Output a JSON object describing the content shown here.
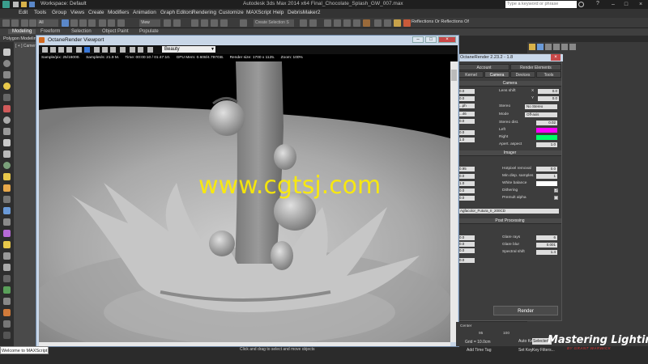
{
  "window": {
    "title": "Autodesk 3ds Max 2014 x64     Final_Chocolate_Splash_GW_007.max",
    "workspace": "Workspace: Default",
    "search_placeholder": "Type a keyword or phrase"
  },
  "menu": [
    "Edit",
    "Tools",
    "Group",
    "Views",
    "Create",
    "Modifiers",
    "Animation",
    "Graph Editors",
    "Rendering",
    "Customize",
    "MAXScript",
    "Help",
    "DebrisMaker2"
  ],
  "toolbar": {
    "filter_dropdown": "All",
    "coord_dropdown": "View",
    "selection_set": "Create Selection S",
    "reflections_label": "Reflections Or Reflections Of"
  },
  "ribbon": {
    "tabs": [
      "Modeling",
      "Freeform",
      "Selection",
      "Object Paint",
      "Populate"
    ],
    "active": "Modeling",
    "sub_label": "Polygon Modeling"
  },
  "background_viewport": {
    "label": "[ + ] Camer"
  },
  "octane": {
    "title": "OctaneRender Viewport",
    "render_pass": "Beauty",
    "stats": {
      "samples_pix": "Sample/pix: 25/16000.",
      "samples_rate": "Samples/s: 21.9 M.",
      "time": "Time: 00:00:10 / 01:47:10.",
      "gpu_mem": "GPU Mem: 0.608/4.797GB.",
      "render_size": "Render size: 1700 x 1125.",
      "zoom": "Zoom: 100%"
    },
    "watermark": "www.cgtsj.com"
  },
  "render_setup": {
    "title": "OctaneRender 2.23.2 - 1.8",
    "tabs_row1": [
      "Account",
      "Render Elements"
    ],
    "tabs_row2": [
      "Kernel",
      "Camera",
      "Devices",
      "Tools"
    ],
    "active_tab": "Camera",
    "camera": {
      "header": "Camera",
      "lens_shift_label": "Lens shift",
      "lens_x_label": "X",
      "lens_x": "0.0",
      "lens_y_label": "Y",
      "lens_y": "0.0",
      "stereo_label": "Stereo",
      "stereo_value": "No Stereo",
      "mode_label": "Mode",
      "mode_value": "Off-axis",
      "stereo_dist_label": "Stereo dist.",
      "stereo_dist": "0.02",
      "left_label": "Left",
      "right_label": "Right",
      "apert_aspect_label": "Apert. aspect",
      "apert_aspect": "1.0",
      "left_color": "#ff00ff",
      "right_color": "#00ff66",
      "side_values": [
        "0.0",
        "0.0",
        "...ph",
        "...46",
        "0.0",
        "0.0",
        "1.0"
      ]
    },
    "imager": {
      "header": "Imager",
      "hotpixel_label": "Hotpixel removal",
      "hotpixel": "0.0",
      "min_disp_label": "Min disp. samples",
      "min_disp": "1",
      "white_balance_label": "White balance",
      "dithering_label": "Dithering",
      "dithering_checked": true,
      "premult_label": "Premult alpha",
      "premult_checked": false,
      "response_curve": "Agfacolor_Futura_II_200CD",
      "side_values": [
        "0.95",
        "0.0",
        "1.0",
        "0.0",
        "0.0"
      ]
    },
    "post": {
      "header": "Post Processing",
      "glare_rays_label": "Glare rays",
      "glare_rays": "6",
      "glare_blur_label": "Glare blur",
      "glare_blur": "0.001",
      "spectral_shift_label": "Spectral shift",
      "spectral_shift": "1.4",
      "side_values": [
        "0.0",
        "0.0",
        "0.0",
        "0.0"
      ]
    },
    "render_button": "Render"
  },
  "timeline": {
    "tick_95": "95",
    "tick_100": "100",
    "center_label": "Center"
  },
  "status": {
    "listener": "Welcome to MAXScript.",
    "prompt": "Click and drag to select and move objects",
    "grid": "Grid = 10.0cm",
    "add_time_tag": "Add Time Tag",
    "auto_key": "Auto Key",
    "set_key": "Set Key",
    "selected": "Selected",
    "key_filters": "Key Filters..."
  },
  "brand": {
    "name": "Mastering Lighting",
    "sub": "BY GRANT WARWICK"
  }
}
